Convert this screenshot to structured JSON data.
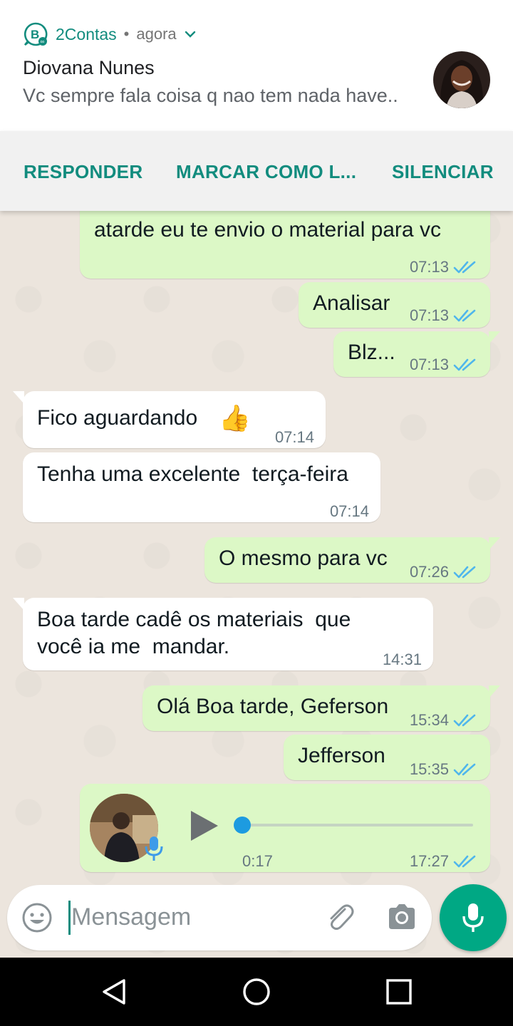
{
  "notification": {
    "app_name": "2Contas",
    "separator": "•",
    "time": "agora",
    "sender": "Diovana Nunes",
    "preview": "Vc sempre fala coisa q nao tem nada have..",
    "actions": [
      "RESPONDER",
      "MARCAR COMO L...",
      "SILENCIAR"
    ]
  },
  "messages": [
    {
      "dir": "out",
      "text": "atarde eu te envio o material para vc",
      "time": "07:13",
      "status": "read"
    },
    {
      "dir": "out",
      "text": "Analisar",
      "time": "07:13",
      "status": "read"
    },
    {
      "dir": "out",
      "text": "Blz...",
      "time": "07:13",
      "status": "read"
    },
    {
      "dir": "in",
      "text": "Fico aguardando",
      "emoji": "👍",
      "time": "07:14"
    },
    {
      "dir": "in",
      "text": "Tenha uma excelente  terça-feira",
      "time": "07:14"
    },
    {
      "dir": "out",
      "text": "O mesmo para vc",
      "time": "07:26",
      "status": "read"
    },
    {
      "dir": "in",
      "text": "Boa tarde cadê os materiais  que\nvocê ia me  mandar.",
      "time": "14:31"
    },
    {
      "dir": "out",
      "text": "Olá Boa tarde, Geferson",
      "time": "15:34",
      "status": "read"
    },
    {
      "dir": "out",
      "text": "Jefferson",
      "time": "15:35",
      "status": "read"
    },
    {
      "dir": "out",
      "type": "voice",
      "duration": "0:17",
      "progress": 0,
      "time": "17:27",
      "status": "read"
    }
  ],
  "composer": {
    "placeholder": "Mensagem",
    "icons": [
      "emoji-icon",
      "attach-icon",
      "camera-icon",
      "mic-icon"
    ]
  },
  "navbar": {
    "icons": [
      "back-icon",
      "home-icon",
      "recents-icon"
    ]
  },
  "colors": {
    "accent": "#128c7e",
    "fab": "#00a884",
    "outgoing_bubble": "#dcf8c6",
    "incoming_bubble": "#ffffff",
    "read_ticks": "#4fb6ec"
  }
}
